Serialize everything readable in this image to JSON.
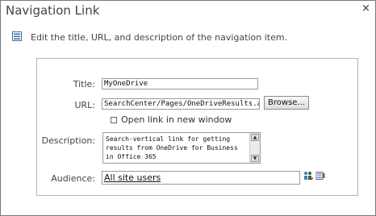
{
  "dialog": {
    "title": "Navigation Link",
    "close_glyph": "×",
    "intro_text": "Edit the title, URL, and description of the navigation item.",
    "intro_icon": "list-icon"
  },
  "form": {
    "title_label": "Title:",
    "title_value": "MyOneDrive",
    "url_label": "URL:",
    "url_value": "SearchCenter/Pages/OneDriveResults.aspx",
    "browse_label": "Browse...",
    "new_window_label": "Open link in new window",
    "description_label": "Description:",
    "description_value": "Search-vertical link for getting results from OneDrive for Business in Office 365",
    "audience_label": "Audience:",
    "audience_value": "All site users"
  },
  "icons": {
    "check_names": "check-names-icon",
    "browse_people": "browse-address-book-icon"
  }
}
